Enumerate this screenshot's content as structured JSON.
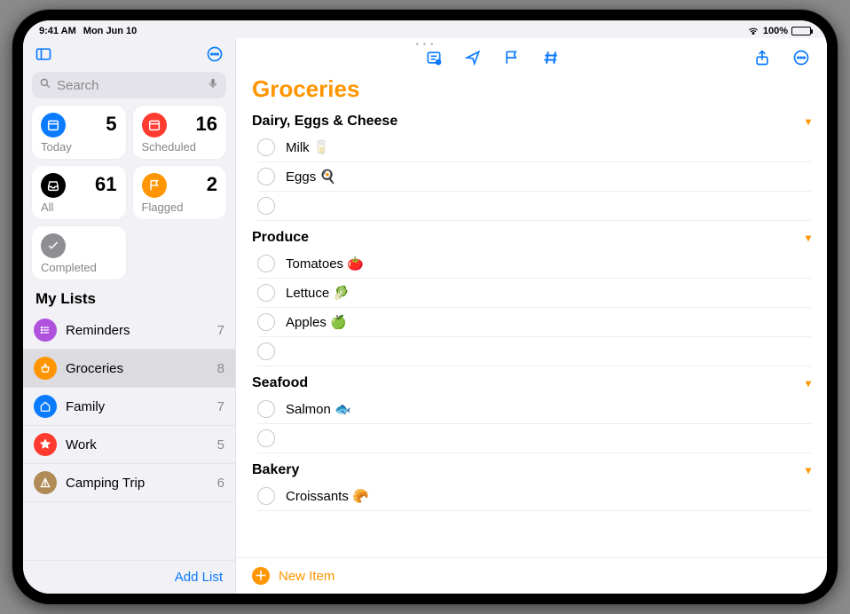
{
  "status": {
    "time": "9:41 AM",
    "date": "Mon Jun 10",
    "battery": "100%"
  },
  "search": {
    "placeholder": "Search"
  },
  "smart": [
    {
      "label": "Today",
      "count": "5",
      "color": "#0a7aff",
      "icon": "calendar"
    },
    {
      "label": "Scheduled",
      "count": "16",
      "color": "#ff3b30",
      "icon": "calendar"
    },
    {
      "label": "All",
      "count": "61",
      "color": "#000000",
      "icon": "tray"
    },
    {
      "label": "Flagged",
      "count": "2",
      "color": "#ff9500",
      "icon": "flag"
    },
    {
      "label": "Completed",
      "count": "",
      "color": "#8e8e93",
      "icon": "check"
    }
  ],
  "lists_header": "My Lists",
  "lists": [
    {
      "name": "Reminders",
      "count": "7",
      "color": "#af52de",
      "icon": "list"
    },
    {
      "name": "Groceries",
      "count": "8",
      "color": "#ff9500",
      "icon": "basket",
      "selected": true
    },
    {
      "name": "Family",
      "count": "7",
      "color": "#0a7aff",
      "icon": "house"
    },
    {
      "name": "Work",
      "count": "5",
      "color": "#ff3b30",
      "icon": "star"
    },
    {
      "name": "Camping Trip",
      "count": "6",
      "color": "#b08b57",
      "icon": "tent"
    }
  ],
  "add_list": "Add List",
  "main": {
    "title": "Groceries",
    "new_item": "New Item",
    "sections": [
      {
        "title": "Dairy, Eggs & Cheese",
        "items": [
          "Milk 🥛",
          "Eggs 🍳",
          ""
        ]
      },
      {
        "title": "Produce",
        "items": [
          "Tomatoes 🍅",
          "Lettuce 🥬",
          "Apples 🍏",
          ""
        ]
      },
      {
        "title": "Seafood",
        "items": [
          "Salmon 🐟",
          ""
        ]
      },
      {
        "title": "Bakery",
        "items": [
          "Croissants 🥐"
        ]
      }
    ]
  }
}
